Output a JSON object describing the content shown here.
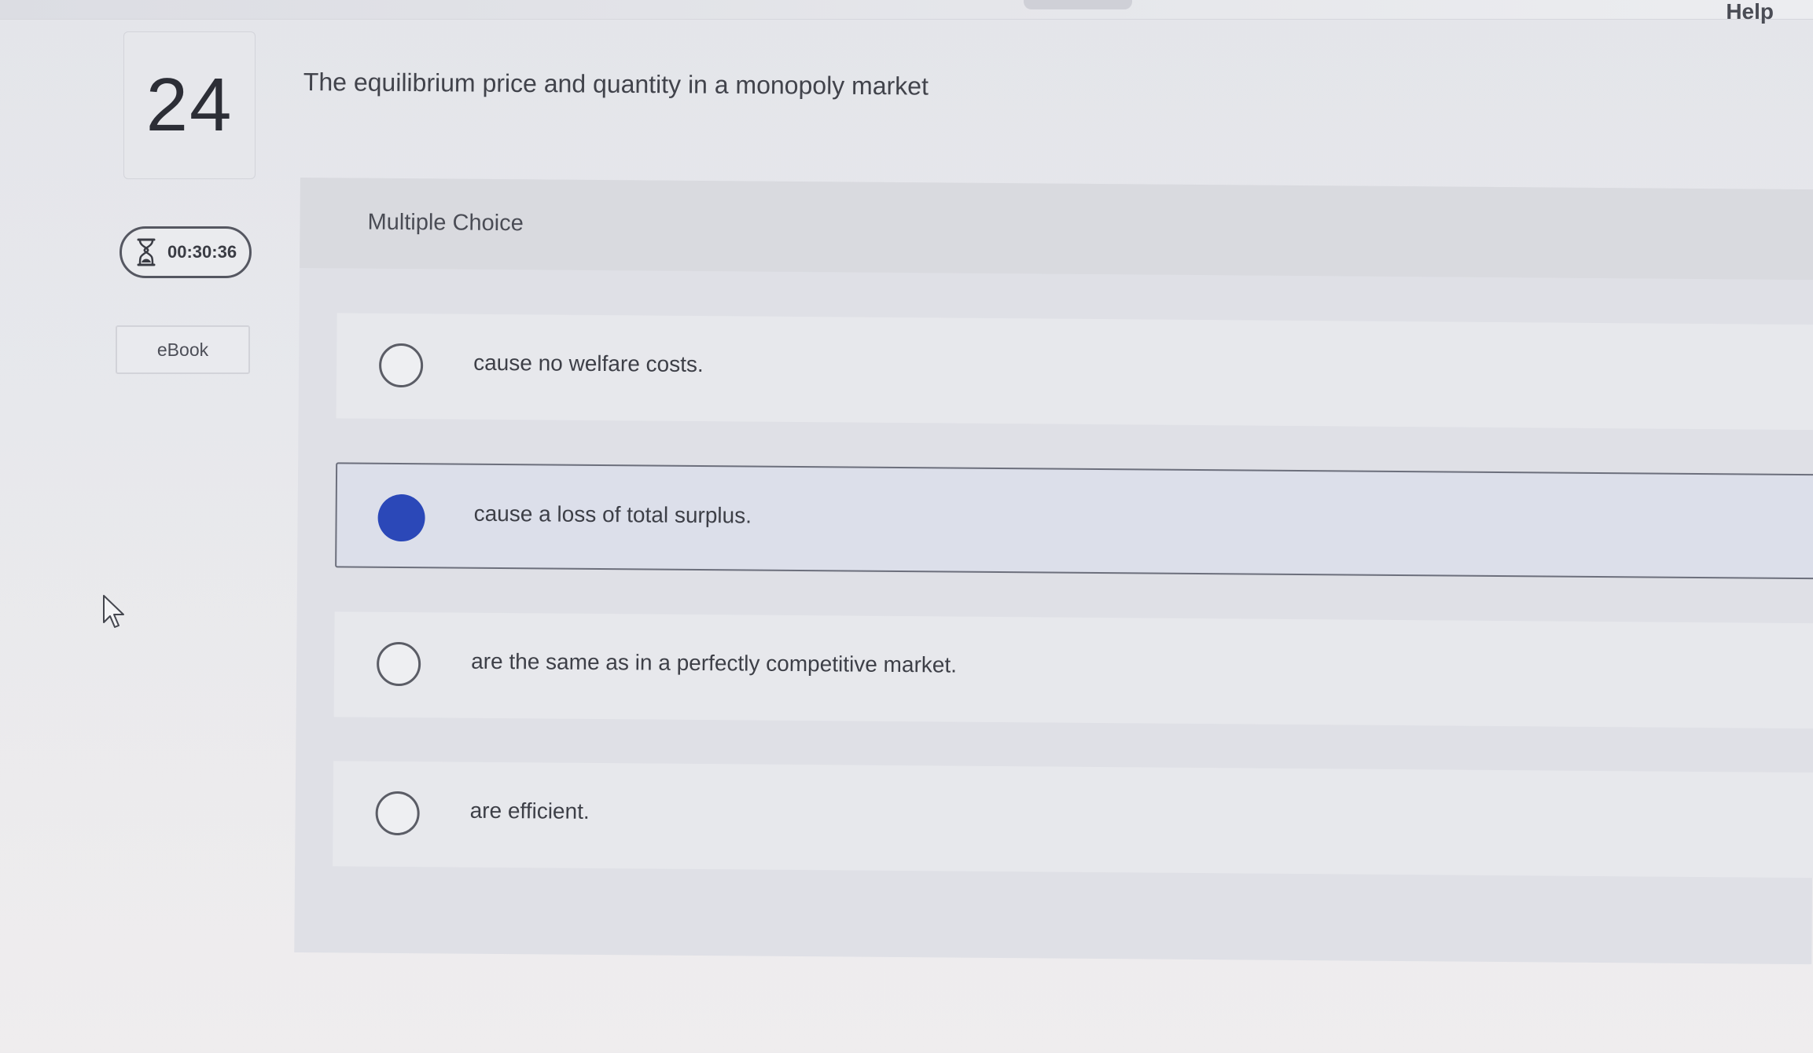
{
  "header": {
    "help_label": "Help"
  },
  "sidebar": {
    "question_number": "24",
    "timer": "00:30:36",
    "timer_icon": "hourglass-icon",
    "ebook_label": "eBook"
  },
  "question": {
    "prompt": "The equilibrium price and quantity in a monopoly market",
    "type_label": "Multiple Choice",
    "options": [
      {
        "label": "cause no welfare costs.",
        "selected": false
      },
      {
        "label": "cause a loss of total surplus.",
        "selected": true
      },
      {
        "label": "are the same as in a perfectly competitive market.",
        "selected": false
      },
      {
        "label": "are efficient.",
        "selected": false
      }
    ]
  },
  "colors": {
    "selected_radio": "#2b48b8",
    "selected_row": "#dcdfea"
  }
}
